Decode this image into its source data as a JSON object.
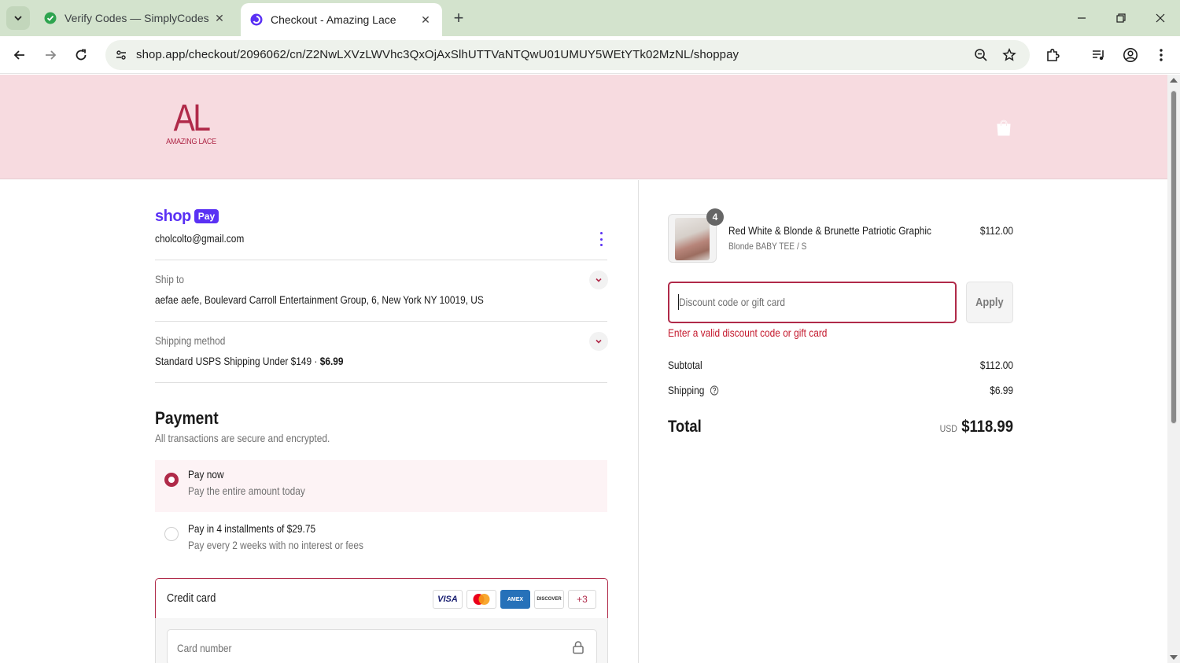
{
  "browser": {
    "tabs": [
      {
        "title": "Verify Codes — SimplyCodes",
        "active": false,
        "favicon": "simplycodes-icon"
      },
      {
        "title": "Checkout - Amazing Lace",
        "active": true,
        "favicon": "shop-icon"
      }
    ],
    "url": "shop.app/checkout/2096062/cn/Z2NwLXVzLWVhc3QxOjAxSlhUTTVaNTQwU01UMUY5WEtYTk02MzNL/shoppay"
  },
  "header": {
    "logo_monogram": "AL",
    "logo_text": "AMAZING LACE"
  },
  "account": {
    "brand_word": "shop",
    "brand_pay": "Pay",
    "email": "cholcolto@gmail.com"
  },
  "ship_to": {
    "label": "Ship to",
    "value": "aefae aefe, Boulevard Carroll Entertainment Group, 6, New York NY 10019, US"
  },
  "shipping_method": {
    "label": "Shipping method",
    "value": "Standard USPS Shipping Under $149 · ",
    "price": "$6.99"
  },
  "payment": {
    "title": "Payment",
    "subtitle": "All transactions are secure and encrypted.",
    "options": [
      {
        "title": "Pay now",
        "subtitle": "Pay the entire amount today",
        "selected": true
      },
      {
        "title": "Pay in 4 installments of $29.75",
        "subtitle": "Pay every 2 weeks with no interest or fees",
        "selected": false
      }
    ],
    "credit_card_label": "Credit card",
    "card_brands": [
      "VISA",
      "mastercard",
      "AMEX",
      "DISCOVER"
    ],
    "more_cards": "+3",
    "card_number_placeholder": "Card number"
  },
  "order": {
    "product": {
      "name": "Red White & Blonde & Brunette Patriotic Graphic",
      "variant": "Blonde BABY TEE / S",
      "price": "$112.00",
      "quantity": "4"
    },
    "discount_placeholder": "Discount code or gift card",
    "apply_label": "Apply",
    "error": "Enter a valid discount code or gift card",
    "subtotal_label": "Subtotal",
    "subtotal": "$112.00",
    "shipping_label": "Shipping",
    "shipping": "$6.99",
    "total_label": "Total",
    "currency": "USD",
    "total": "$118.99"
  },
  "colors": {
    "brand": "#b02a49",
    "header_bg": "#f7dbe0",
    "shop_pay": "#5a31f4",
    "error": "#c4182c"
  }
}
